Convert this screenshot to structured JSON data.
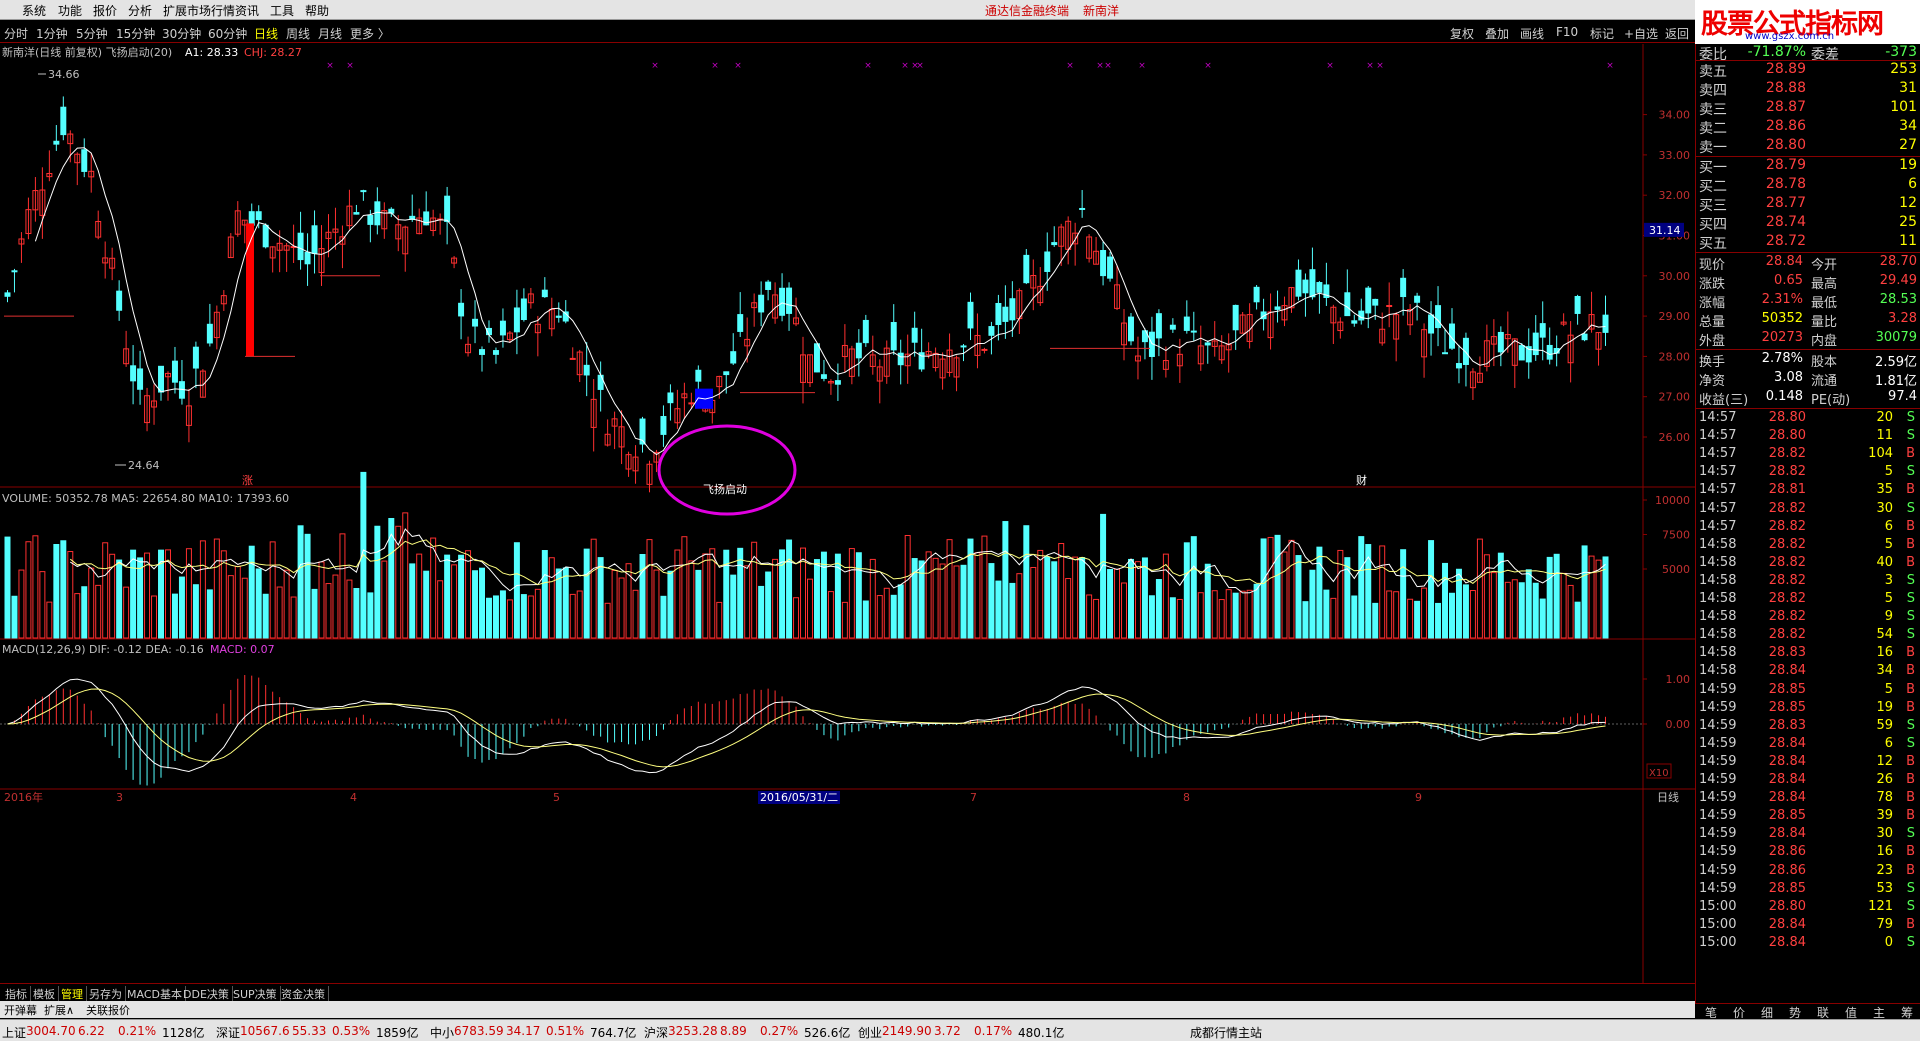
{
  "menu": {
    "items": [
      "系统",
      "功能",
      "报价",
      "分析",
      "扩展市场行情",
      "资讯",
      "工具",
      "帮助"
    ],
    "title": "通达信金融终端",
    "stock": "新南洋"
  },
  "logo": {
    "main": "股票公式指标网",
    "url": "www.gszx.com.cn"
  },
  "periods": {
    "items": [
      "分时",
      "1分钟",
      "5分钟",
      "15分钟",
      "30分钟",
      "60分钟",
      "日线",
      "周线",
      "月线",
      "更多 〉"
    ],
    "active": "日线",
    "right": [
      "复权",
      "叠加",
      "画线",
      "F10",
      "标记",
      "+自选",
      "返回"
    ]
  },
  "main_chart": {
    "header": "新南洋(日线 前复权) 飞扬启动(20)",
    "a1_label": "A1: 28.33",
    "chj_label": "CHJ: 28.27",
    "high_label": "34.66",
    "low_label": "24.64",
    "annotation": "飞扬启动",
    "marker_zhang": "涨",
    "marker_cai": "财",
    "price_ticks": [
      "34.00",
      "33.00",
      "32.00",
      "31.00",
      "30.00",
      "29.00",
      "28.00",
      "27.00",
      "26.00"
    ],
    "current_box": "31.14"
  },
  "volume_chart": {
    "header": "VOLUME: 50352.78  MA5: 22654.80  MA10: 17393.60",
    "ticks": [
      "10000",
      "7500",
      "5000"
    ],
    "unit": "X10"
  },
  "macd_chart": {
    "header_main": "MACD(12,26,9)  DIF: -0.12  DEA: -0.16",
    "header_macd": "MACD: 0.07",
    "ticks": [
      "1.00",
      "0.00"
    ]
  },
  "time_axis": {
    "labels": [
      "2016年",
      "3",
      "4",
      "5",
      "2016/05/31/二",
      "7",
      "8",
      "9"
    ],
    "right": "日线"
  },
  "quote": {
    "top_partial": {
      "label": "委比",
      "value": "-71.87%",
      "label2": "委差",
      "value2": "-373"
    },
    "asks": [
      {
        "label": "卖五",
        "price": "28.89",
        "vol": "253"
      },
      {
        "label": "卖四",
        "price": "28.88",
        "vol": "31"
      },
      {
        "label": "卖三",
        "price": "28.87",
        "vol": "101"
      },
      {
        "label": "卖二",
        "price": "28.86",
        "vol": "34"
      },
      {
        "label": "卖一",
        "price": "28.80",
        "vol": "27"
      }
    ],
    "bids": [
      {
        "label": "买一",
        "price": "28.79",
        "vol": "19"
      },
      {
        "label": "买二",
        "price": "28.78",
        "vol": "6"
      },
      {
        "label": "买三",
        "price": "28.77",
        "vol": "12"
      },
      {
        "label": "买四",
        "price": "28.74",
        "vol": "25"
      },
      {
        "label": "买五",
        "price": "28.72",
        "vol": "11"
      }
    ],
    "stats": [
      {
        "l1": "现价",
        "v1": "28.84",
        "l2": "今开",
        "v2": "28.70"
      },
      {
        "l1": "涨跌",
        "v1": "0.65",
        "l2": "最高",
        "v2": "29.49"
      },
      {
        "l1": "涨幅",
        "v1": "2.31%",
        "l2": "最低",
        "v2": "28.53"
      },
      {
        "l1": "总量",
        "v1": "50352",
        "l2": "量比",
        "v2": "3.28"
      },
      {
        "l1": "外盘",
        "v1": "20273",
        "l2": "内盘",
        "v2": "30079"
      }
    ],
    "stats2": [
      {
        "l1": "换手",
        "v1": "2.78%",
        "l2": "股本",
        "v2": "2.59亿"
      },
      {
        "l1": "净资",
        "v1": "3.08",
        "l2": "流通",
        "v2": "1.81亿"
      },
      {
        "l1": "收益(三)",
        "v1": "0.148",
        "l2": "PE(动)",
        "v2": "97.4"
      }
    ],
    "ticks": [
      {
        "t": "14:57",
        "p": "28.80",
        "n": "20",
        "d": "S"
      },
      {
        "t": "14:57",
        "p": "28.80",
        "n": "11",
        "d": "S"
      },
      {
        "t": "14:57",
        "p": "28.82",
        "n": "104",
        "d": "B"
      },
      {
        "t": "14:57",
        "p": "28.82",
        "n": "5",
        "d": "S"
      },
      {
        "t": "14:57",
        "p": "28.81",
        "n": "35",
        "d": "B"
      },
      {
        "t": "14:57",
        "p": "28.82",
        "n": "30",
        "d": "S"
      },
      {
        "t": "14:57",
        "p": "28.82",
        "n": "6",
        "d": "B"
      },
      {
        "t": "14:58",
        "p": "28.82",
        "n": "5",
        "d": "B"
      },
      {
        "t": "14:58",
        "p": "28.82",
        "n": "40",
        "d": "B"
      },
      {
        "t": "14:58",
        "p": "28.82",
        "n": "3",
        "d": "S"
      },
      {
        "t": "14:58",
        "p": "28.82",
        "n": "5",
        "d": "S"
      },
      {
        "t": "14:58",
        "p": "28.82",
        "n": "9",
        "d": "S"
      },
      {
        "t": "14:58",
        "p": "28.82",
        "n": "54",
        "d": "S"
      },
      {
        "t": "14:58",
        "p": "28.83",
        "n": "16",
        "d": "B"
      },
      {
        "t": "14:58",
        "p": "28.84",
        "n": "34",
        "d": "B"
      },
      {
        "t": "14:59",
        "p": "28.85",
        "n": "5",
        "d": "B"
      },
      {
        "t": "14:59",
        "p": "28.85",
        "n": "19",
        "d": "B"
      },
      {
        "t": "14:59",
        "p": "28.83",
        "n": "59",
        "d": "S"
      },
      {
        "t": "14:59",
        "p": "28.84",
        "n": "6",
        "d": "S"
      },
      {
        "t": "14:59",
        "p": "28.84",
        "n": "12",
        "d": "B"
      },
      {
        "t": "14:59",
        "p": "28.84",
        "n": "26",
        "d": "B"
      },
      {
        "t": "14:59",
        "p": "28.84",
        "n": "78",
        "d": "B"
      },
      {
        "t": "14:59",
        "p": "28.85",
        "n": "39",
        "d": "B"
      },
      {
        "t": "14:59",
        "p": "28.84",
        "n": "30",
        "d": "S"
      },
      {
        "t": "14:59",
        "p": "28.86",
        "n": "16",
        "d": "B"
      },
      {
        "t": "14:59",
        "p": "28.86",
        "n": "23",
        "d": "B"
      },
      {
        "t": "14:59",
        "p": "28.85",
        "n": "53",
        "d": "S"
      },
      {
        "t": "15:00",
        "p": "28.80",
        "n": "121",
        "d": "S"
      },
      {
        "t": "15:00",
        "p": "28.84",
        "n": "79",
        "d": "B"
      },
      {
        "t": "15:00",
        "p": "28.84",
        "n": "0",
        "d": "S"
      }
    ],
    "tabs": [
      "笔",
      "价",
      "细",
      "势",
      "联",
      "值",
      "主",
      "筹"
    ]
  },
  "bottom_tabs": {
    "row1": [
      "指标",
      "模板",
      "管理",
      "另存为",
      "MACD基本",
      "DDE决策",
      "SUP决策",
      "资金决策"
    ],
    "active": "管理",
    "row2": [
      "开弹幕",
      "扩展∧",
      "关联报价"
    ]
  },
  "status": {
    "items": [
      {
        "name": "上证",
        "val": "3004.70",
        "chg": "6.22",
        "pct": "0.21%",
        "amt": "1128亿"
      },
      {
        "name": "深证",
        "val": "10567.6",
        "chg": "55.33",
        "pct": "0.53%",
        "amt": "1859亿"
      },
      {
        "name": "中小",
        "val": "6783.59",
        "chg": "34.17",
        "pct": "0.51%",
        "amt": "764.7亿"
      },
      {
        "name": "沪深",
        "val": "3253.28",
        "chg": "8.89",
        "pct": "0.27%",
        "amt": "526.6亿"
      },
      {
        "name": "创业",
        "val": "2149.90",
        "chg": "3.72",
        "pct": "0.17%",
        "amt": "480.1亿"
      }
    ],
    "site": "成都行情主站"
  },
  "colors": {
    "up": "#ff3030",
    "down": "#54ffff",
    "ma": "#ffffff",
    "ma10": "#ffff80",
    "circle": "#e000e0",
    "marker": "#0000ff"
  }
}
